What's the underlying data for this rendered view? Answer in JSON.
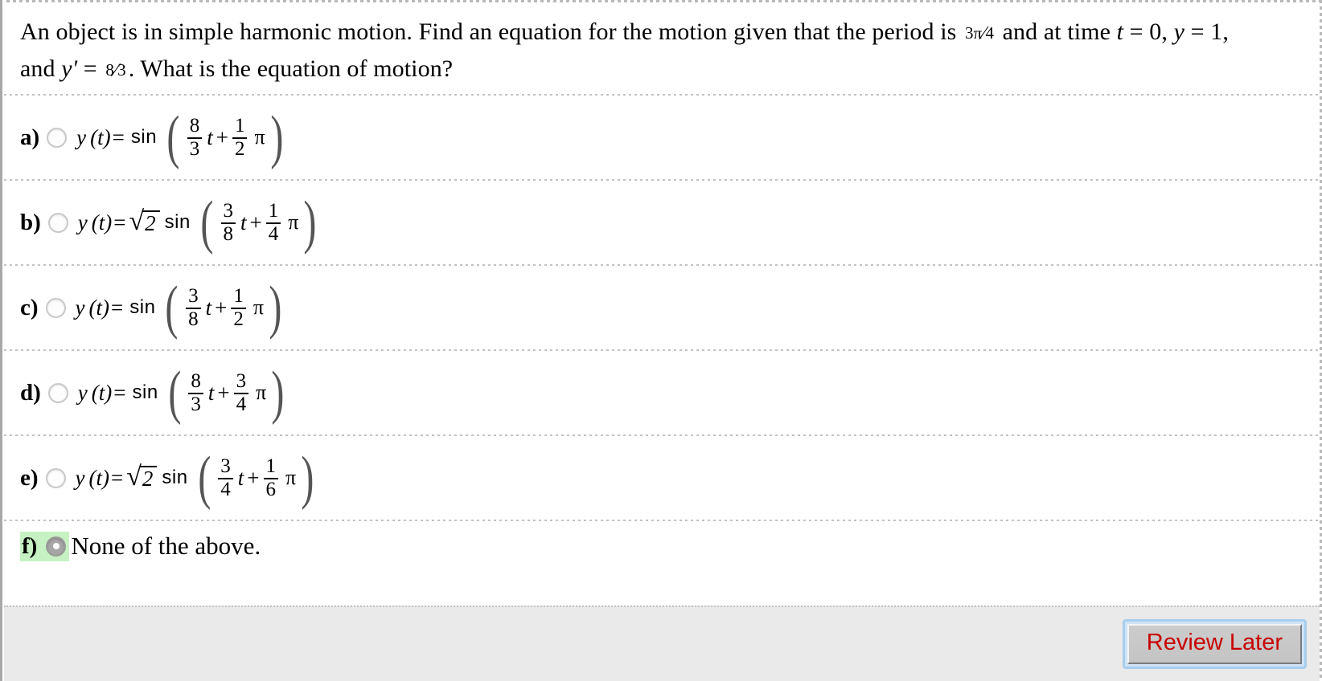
{
  "question": {
    "line1_part1": "An object is in simple harmonic motion. Find an equation for the motion given that the period is ",
    "period_num": "3π",
    "period_den": "4",
    "line1_part2": " and at time ",
    "t_var": "t",
    "t_val": " = 0, ",
    "y_var": "y",
    "y_val": " = 1,",
    "line2_prefix": "and ",
    "yprime_var": "y'",
    "yprime_eq": " = ",
    "yprime_num": "8",
    "yprime_den": "3",
    "line2_suffix": ". What is the equation of motion?"
  },
  "options": [
    {
      "letter": "a)",
      "selected": false,
      "lhs": "y",
      "lhs_arg": "(t)",
      "equals": "=",
      "coefficient": "",
      "func": "sin",
      "inner_num1": "8",
      "inner_den1": "3",
      "inner_var": "t",
      "inner_plus": "+",
      "inner_num2": "1",
      "inner_den2": "2",
      "inner_pi": "π"
    },
    {
      "letter": "b)",
      "selected": false,
      "lhs": "y",
      "lhs_arg": "(t)",
      "equals": "=",
      "coefficient": "2",
      "func": "sin",
      "inner_num1": "3",
      "inner_den1": "8",
      "inner_var": "t",
      "inner_plus": "+",
      "inner_num2": "1",
      "inner_den2": "4",
      "inner_pi": "π"
    },
    {
      "letter": "c)",
      "selected": false,
      "lhs": "y",
      "lhs_arg": "(t)",
      "equals": "=",
      "coefficient": "",
      "func": "sin",
      "inner_num1": "3",
      "inner_den1": "8",
      "inner_var": "t",
      "inner_plus": "+",
      "inner_num2": "1",
      "inner_den2": "2",
      "inner_pi": "π"
    },
    {
      "letter": "d)",
      "selected": false,
      "lhs": "y",
      "lhs_arg": "(t)",
      "equals": "=",
      "coefficient": "",
      "func": "sin",
      "inner_num1": "8",
      "inner_den1": "3",
      "inner_var": "t",
      "inner_plus": "+",
      "inner_num2": "3",
      "inner_den2": "4",
      "inner_pi": "π"
    },
    {
      "letter": "e)",
      "selected": false,
      "lhs": "y",
      "lhs_arg": "(t)",
      "equals": "=",
      "coefficient": "2",
      "func": "sin",
      "inner_num1": "3",
      "inner_den1": "4",
      "inner_var": "t",
      "inner_plus": "+",
      "inner_num2": "1",
      "inner_den2": "6",
      "inner_pi": "π"
    }
  ],
  "option_f": {
    "letter": "f)",
    "selected": true,
    "text": "None of the above."
  },
  "footer": {
    "review_later_label": "Review Later"
  },
  "colors": {
    "highlight_green": "#c6f2c3",
    "review_text_red": "#c80000",
    "bottom_bar_gray": "#eaeaea",
    "focus_ring_blue": "#a8cdec"
  }
}
